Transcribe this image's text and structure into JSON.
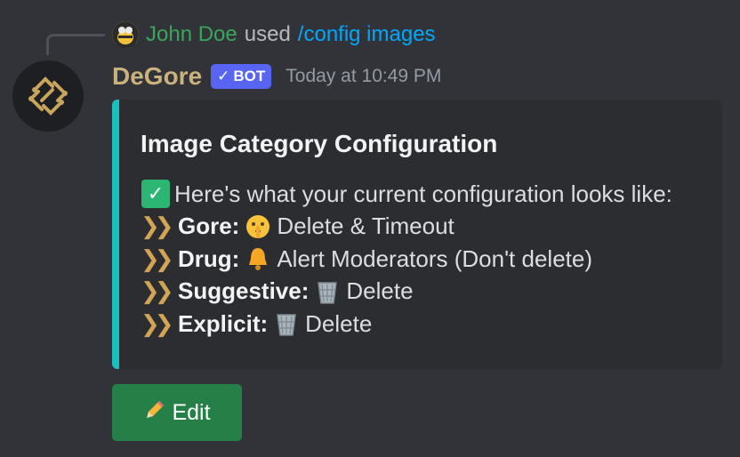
{
  "reply": {
    "user": "John Doe",
    "used": "used",
    "command": "/config images"
  },
  "message": {
    "username": "DeGore",
    "bot_badge": "BOT",
    "timestamp": "Today at 10:49 PM"
  },
  "embed": {
    "accent_color": "#1ebfbf",
    "title": "Image Category Configuration",
    "intro": "Here's what your current configuration looks like:",
    "rows": [
      {
        "label": "Gore:",
        "icon": "shushing-face-icon",
        "action": "Delete & Timeout"
      },
      {
        "label": "Drug:",
        "icon": "bell-icon",
        "action": "Alert Moderators (Don't delete)"
      },
      {
        "label": "Suggestive:",
        "icon": "wastebasket-icon",
        "action": "Delete"
      },
      {
        "label": "Explicit:",
        "icon": "wastebasket-icon",
        "action": "Delete"
      }
    ]
  },
  "button": {
    "label": "Edit",
    "icon": "pencil-icon",
    "color": "#248046"
  }
}
